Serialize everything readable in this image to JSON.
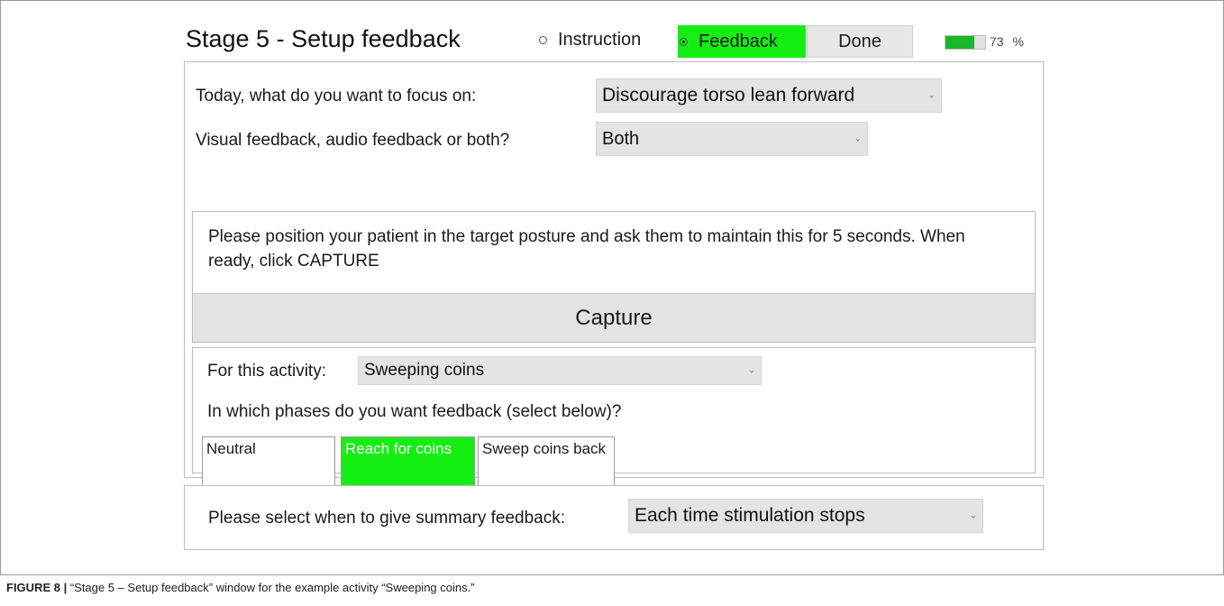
{
  "window": {
    "title": "Stage 5 - Setup feedback",
    "mode_options": [
      {
        "label": "Instruction",
        "selected": false
      },
      {
        "label": "Feedback",
        "selected": true
      }
    ],
    "done_label": "Done",
    "battery": {
      "value": "73",
      "unit": "%",
      "level": 0.73,
      "color": "#19b628"
    }
  },
  "focus": {
    "label": "Today, what do you want to focus on:",
    "value": "Discourage torso lean forward"
  },
  "feedback_type": {
    "label": "Visual feedback, audio feedback or both?",
    "value": "Both"
  },
  "capture": {
    "instruction": "Please position your patient in the target posture and ask them to maintain this for 5 seconds. When ready, click CAPTURE",
    "button_label": "Capture"
  },
  "activity": {
    "label": "For this activity:",
    "value": "Sweeping coins",
    "phases_prompt": "In which phases do you want feedback (select below)?",
    "phases": [
      {
        "label": "Neutral",
        "selected": false
      },
      {
        "label": "Reach for coins",
        "selected": true
      },
      {
        "label": "Sweep coins back",
        "selected": false
      }
    ]
  },
  "summary": {
    "label": "Please select when to give summary feedback:",
    "value": "Each time stimulation stops"
  },
  "caption": {
    "prefix": "FIGURE 8 |",
    "text": " “Stage 5 – Setup feedback” window for the example activity “Sweeping coins.”"
  },
  "colors": {
    "active_green": "#15ee12",
    "select_bg": "#e4e4e4"
  }
}
